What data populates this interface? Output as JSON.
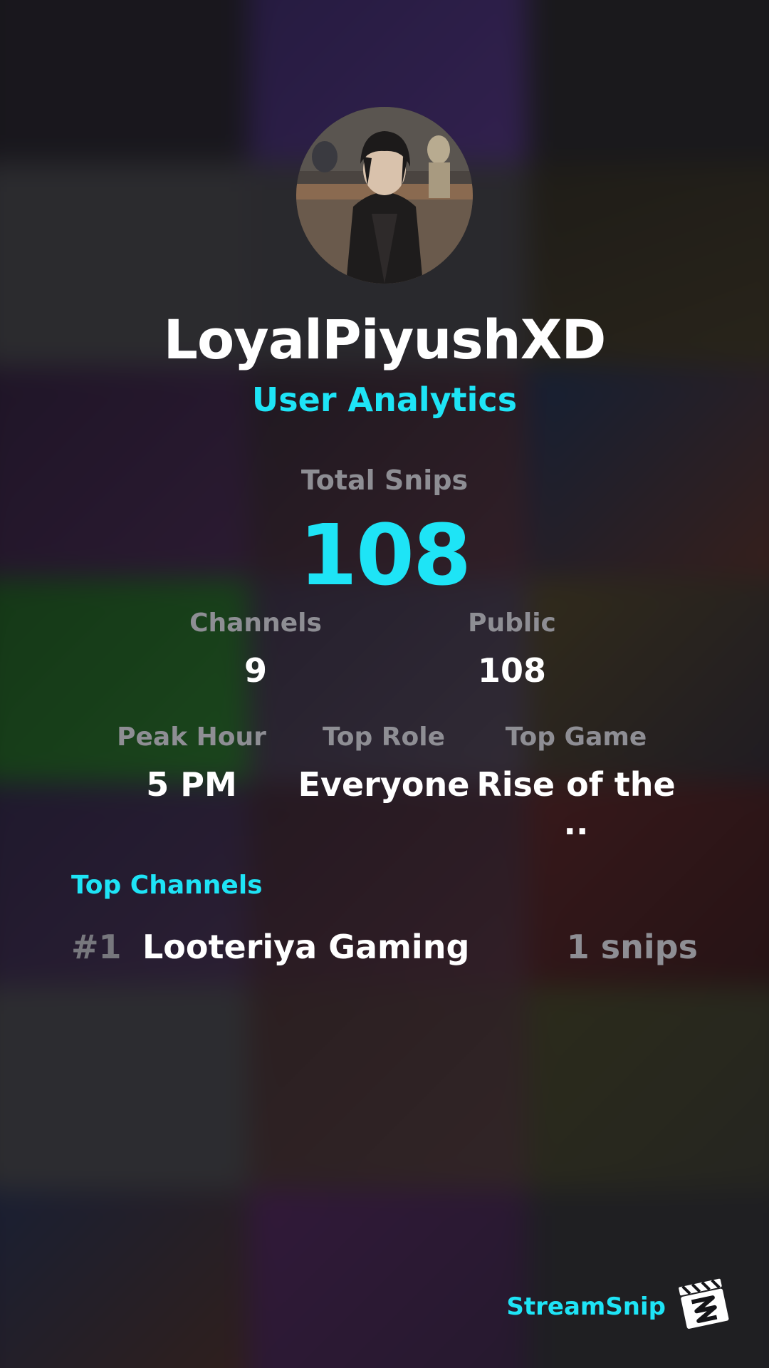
{
  "profile": {
    "username": "LoyalPiyushXD",
    "subtitle": "User Analytics"
  },
  "total": {
    "label": "Total Snips",
    "value": "108"
  },
  "stats_row1": [
    {
      "label": "Channels",
      "value": "9"
    },
    {
      "label": "Public",
      "value": "108"
    }
  ],
  "stats_row2": [
    {
      "label": "Peak Hour",
      "value": "5 PM"
    },
    {
      "label": "Top Role",
      "value": "Everyone"
    },
    {
      "label": "Top Game",
      "value": "Rise of the .."
    }
  ],
  "top_channels": {
    "title": "Top Channels",
    "items": [
      {
        "rank": "#1",
        "name": "Looteriya Gaming",
        "count": "1 snips"
      }
    ]
  },
  "brand": {
    "name": "StreamSnip",
    "logo_icon": "clapperboard-icon"
  },
  "colors": {
    "accent": "#1ee4f6",
    "label_gray": "#8e8e94",
    "text_white": "#ffffff"
  }
}
